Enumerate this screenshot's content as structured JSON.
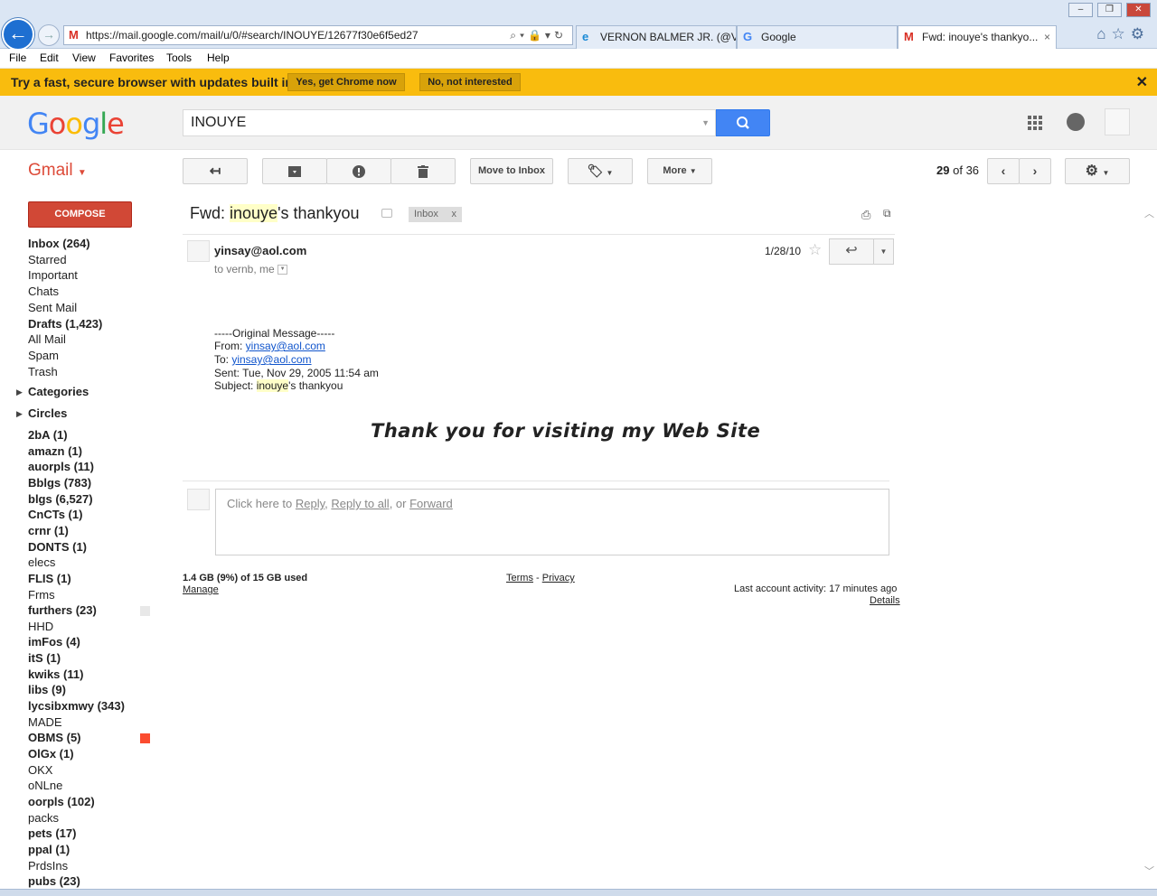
{
  "browser": {
    "url": "https://mail.google.com/mail/u/0/#search/INOUYE/12677f30e6f5ed27",
    "tabs": [
      {
        "title": "VERNON BALMER JR. (@V...",
        "icon": "ie-icon"
      },
      {
        "title": "Google",
        "icon": "google-g-icon"
      },
      {
        "title": "Fwd: inouye's thankyo...",
        "icon": "gmail-icon",
        "close": "×"
      }
    ],
    "menu": [
      "File",
      "Edit",
      "View",
      "Favorites",
      "Tools",
      "Help"
    ],
    "window_controls": {
      "minimize": "–",
      "restore": "❐",
      "close": "✕"
    }
  },
  "promo": {
    "text": "Try a fast, secure browser with updates built in",
    "yes_label": "Yes, get Chrome now",
    "no_label": "No, not interested",
    "close": "✕"
  },
  "header": {
    "search_query": "INOUYE",
    "notification_count": ""
  },
  "gmail_label": "Gmail",
  "toolbar": {
    "move_to_inbox": "Move to Inbox",
    "more": "More",
    "pager_current": "29",
    "pager_of": "of",
    "pager_total": "36"
  },
  "sidebar": {
    "compose": "COMPOSE",
    "system": [
      {
        "label": "Inbox (264)",
        "bold": true
      },
      {
        "label": "Starred",
        "bold": false
      },
      {
        "label": "Important",
        "bold": false
      },
      {
        "label": "Chats",
        "bold": false
      },
      {
        "label": "Sent Mail",
        "bold": false
      },
      {
        "label": "Drafts (1,423)",
        "bold": true
      },
      {
        "label": "All Mail",
        "bold": false
      },
      {
        "label": "Spam",
        "bold": false
      },
      {
        "label": "Trash",
        "bold": false
      }
    ],
    "sections": [
      "Categories",
      "Circles"
    ],
    "labels": [
      {
        "label": "2bA (1)",
        "bold": true
      },
      {
        "label": "amazn (1)",
        "bold": true
      },
      {
        "label": "auorpls (11)",
        "bold": true
      },
      {
        "label": "Bblgs (783)",
        "bold": true
      },
      {
        "label": "blgs (6,527)",
        "bold": true
      },
      {
        "label": "CnCTs (1)",
        "bold": true
      },
      {
        "label": "crnr (1)",
        "bold": true
      },
      {
        "label": "DONTS (1)",
        "bold": true
      },
      {
        "label": "elecs",
        "bold": false
      },
      {
        "label": "FLIS (1)",
        "bold": true
      },
      {
        "label": "Frms",
        "bold": false
      },
      {
        "label": "furthers (23)",
        "bold": true,
        "chip": "#e8e8e8"
      },
      {
        "label": "HHD",
        "bold": false
      },
      {
        "label": "imFos (4)",
        "bold": true
      },
      {
        "label": "itS (1)",
        "bold": true
      },
      {
        "label": "kwiks (11)",
        "bold": true
      },
      {
        "label": "libs (9)",
        "bold": true
      },
      {
        "label": "lycsibxmwy (343)",
        "bold": true
      },
      {
        "label": "MADE",
        "bold": false
      },
      {
        "label": "OBMS (5)",
        "bold": true,
        "chip": "#fb4c2f"
      },
      {
        "label": "OlGx (1)",
        "bold": true
      },
      {
        "label": "OKX",
        "bold": false
      },
      {
        "label": "oNLne",
        "bold": false
      },
      {
        "label": "oorpls (102)",
        "bold": true
      },
      {
        "label": "packs",
        "bold": false
      },
      {
        "label": "pets (17)",
        "bold": true
      },
      {
        "label": "ppal (1)",
        "bold": true
      },
      {
        "label": "PrdsIns",
        "bold": false
      },
      {
        "label": "pubs (23)",
        "bold": true
      }
    ]
  },
  "message": {
    "subject_prefix": "Fwd: ",
    "subject_highlight": "inouye",
    "subject_suffix": "'s thankyou",
    "inbox_chip": "Inbox",
    "inbox_chip_x": "x",
    "sender": "yinsay@aol.com",
    "recipients": "to vernb, me",
    "date": "1/28/10",
    "original_header": "-----Original Message-----",
    "from_label": "From: ",
    "from_addr": "yinsay@aol.com",
    "to_label": "To: ",
    "to_addr": "yinsay@aol.com",
    "sent": "Sent: Tue, Nov 29, 2005 11:54 am",
    "subject_line_label": "Subject: ",
    "subject_line_highlight": "inouye",
    "subject_line_suffix": "'s thankyou",
    "body_heading": "Thank you for visiting my Web Site"
  },
  "reply_box": {
    "prefix": "Click here to ",
    "reply": "Reply",
    "sep1": ", ",
    "reply_all": "Reply to all",
    "sep2": ", or ",
    "forward": "Forward"
  },
  "footer": {
    "storage": "1.4 GB (9%) of 15 GB used",
    "manage": "Manage",
    "terms": "Terms",
    "dash": " - ",
    "privacy": "Privacy",
    "activity": "Last account activity: 17 minutes ago",
    "details": "Details"
  },
  "colors": {
    "promo_bg": "#f9bc0e",
    "compose_red": "#d14836",
    "search_blue": "#4285f4",
    "gmail_red": "#dd4b39",
    "link_blue": "#1155cc",
    "highlight": "#ffffc8"
  }
}
